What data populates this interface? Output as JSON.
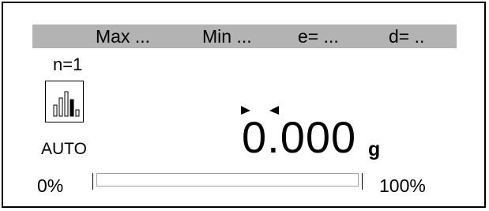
{
  "header": {
    "max": "Max ...",
    "min": "Min ...",
    "e": "e= ...",
    "d": "d= .."
  },
  "counter": "n=1",
  "mode": {
    "label": "AUTO",
    "icon": "histogram-icon"
  },
  "reading": {
    "value": "0.000",
    "unit": "g",
    "stable_indicator": "stability-marker-icon"
  },
  "load_bar": {
    "min_label": "0%",
    "max_label": "100%",
    "fraction": 0
  },
  "colors": {
    "header_background": "#b3b3b3",
    "text": "#000000",
    "background": "#ffffff"
  }
}
